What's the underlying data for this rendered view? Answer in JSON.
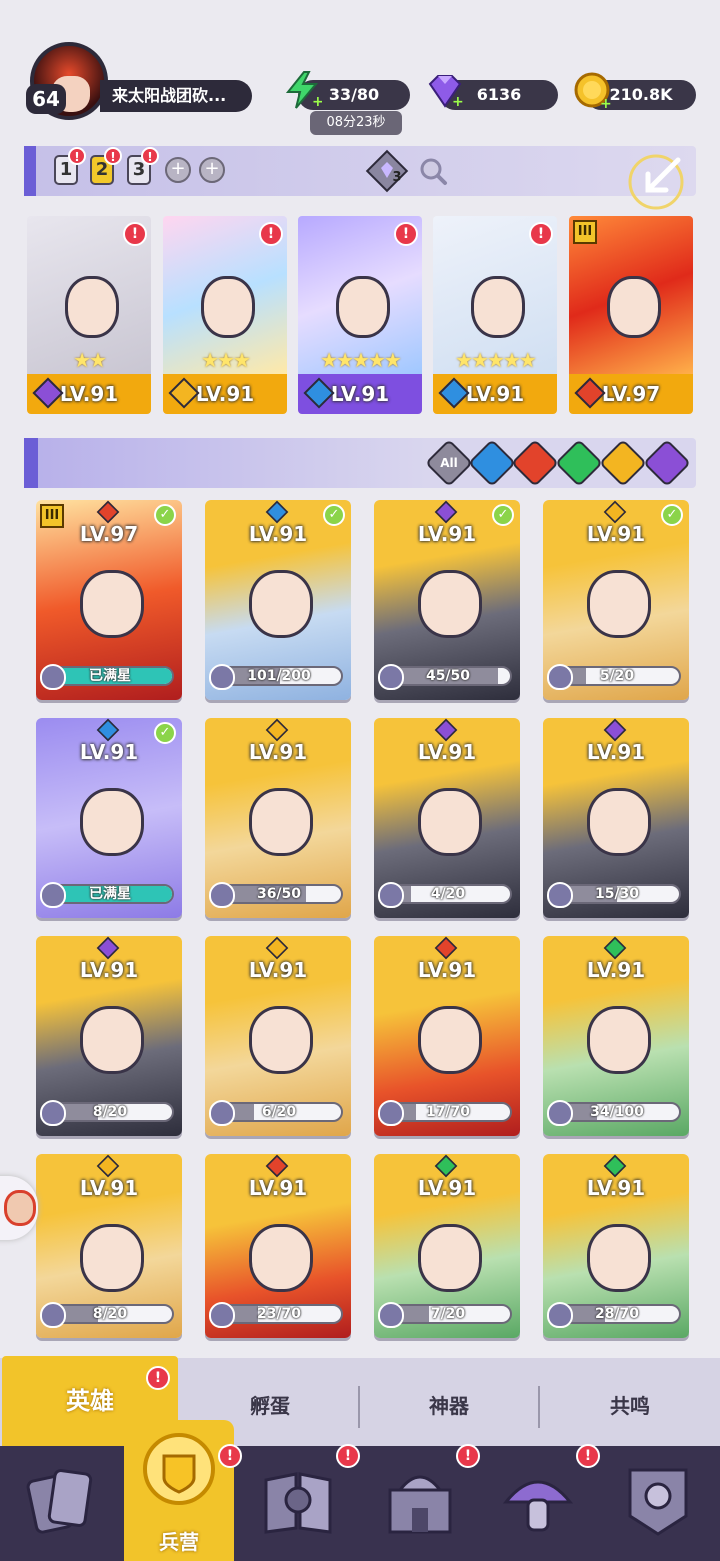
{
  "player": {
    "level": "64",
    "name": "来太阳战团砍..."
  },
  "resources": {
    "energy": "33/80",
    "energy_timer": "08分23秒",
    "gems": "6136",
    "gold": "210.8K"
  },
  "team_tabs": [
    "1",
    "2",
    "3"
  ],
  "team_selected": "2",
  "team_slot_count": "3",
  "team": [
    {
      "level": "LV.91",
      "element": "dark",
      "stars": "★★"
    },
    {
      "level": "LV.91",
      "element": "light",
      "stars": "★★★"
    },
    {
      "level": "LV.91",
      "element": "water",
      "stars": "★★★★★"
    },
    {
      "level": "LV.91",
      "element": "water",
      "stars": "★★★★★"
    },
    {
      "level": "LV.97",
      "element": "fire",
      "stars": ""
    }
  ],
  "filter": {
    "all_label": "All"
  },
  "heroes": [
    {
      "level": "LV.97",
      "progress": "已满星",
      "progress_frac": 1.0,
      "element": "fire",
      "checked": true,
      "full": true
    },
    {
      "level": "LV.91",
      "progress": "101/200",
      "progress_frac": 0.505,
      "element": "water",
      "checked": true
    },
    {
      "level": "LV.91",
      "progress": "45/50",
      "progress_frac": 0.9,
      "element": "dark",
      "checked": true
    },
    {
      "level": "LV.91",
      "progress": "5/20",
      "progress_frac": 0.25,
      "element": "light",
      "checked": true
    },
    {
      "level": "LV.91",
      "progress": "已满星",
      "progress_frac": 1.0,
      "element": "water",
      "checked": true,
      "full": true
    },
    {
      "level": "LV.91",
      "progress": "36/50",
      "progress_frac": 0.72,
      "element": "light",
      "checked": false
    },
    {
      "level": "LV.91",
      "progress": "4/20",
      "progress_frac": 0.2,
      "element": "dark",
      "checked": false
    },
    {
      "level": "LV.91",
      "progress": "15/30",
      "progress_frac": 0.5,
      "element": "dark",
      "checked": false
    },
    {
      "level": "LV.91",
      "progress": "8/20",
      "progress_frac": 0.4,
      "element": "dark",
      "checked": false
    },
    {
      "level": "LV.91",
      "progress": "6/20",
      "progress_frac": 0.3,
      "element": "light",
      "checked": false
    },
    {
      "level": "LV.91",
      "progress": "17/70",
      "progress_frac": 0.243,
      "element": "fire",
      "checked": false
    },
    {
      "level": "LV.91",
      "progress": "34/100",
      "progress_frac": 0.34,
      "element": "nature",
      "checked": false
    },
    {
      "level": "LV.91",
      "progress": "8/20",
      "progress_frac": 0.4,
      "element": "light",
      "checked": false
    },
    {
      "level": "LV.91",
      "progress": "23/70",
      "progress_frac": 0.329,
      "element": "fire",
      "checked": false
    },
    {
      "level": "LV.91",
      "progress": "7/20",
      "progress_frac": 0.35,
      "element": "nature",
      "checked": false
    },
    {
      "level": "LV.91",
      "progress": "28/70",
      "progress_frac": 0.4,
      "element": "nature",
      "checked": false
    }
  ],
  "sub_tabs": [
    "英雄",
    "孵蛋",
    "神器",
    "共鸣"
  ],
  "nav": {
    "selected_label": "兵营"
  },
  "colors": {
    "fire": "#e2432b",
    "water": "#2f8fe0",
    "nature": "#2fbf5a",
    "light": "#f3b521",
    "dark": "#8b4fd6",
    "accent": "#f2c42a"
  }
}
